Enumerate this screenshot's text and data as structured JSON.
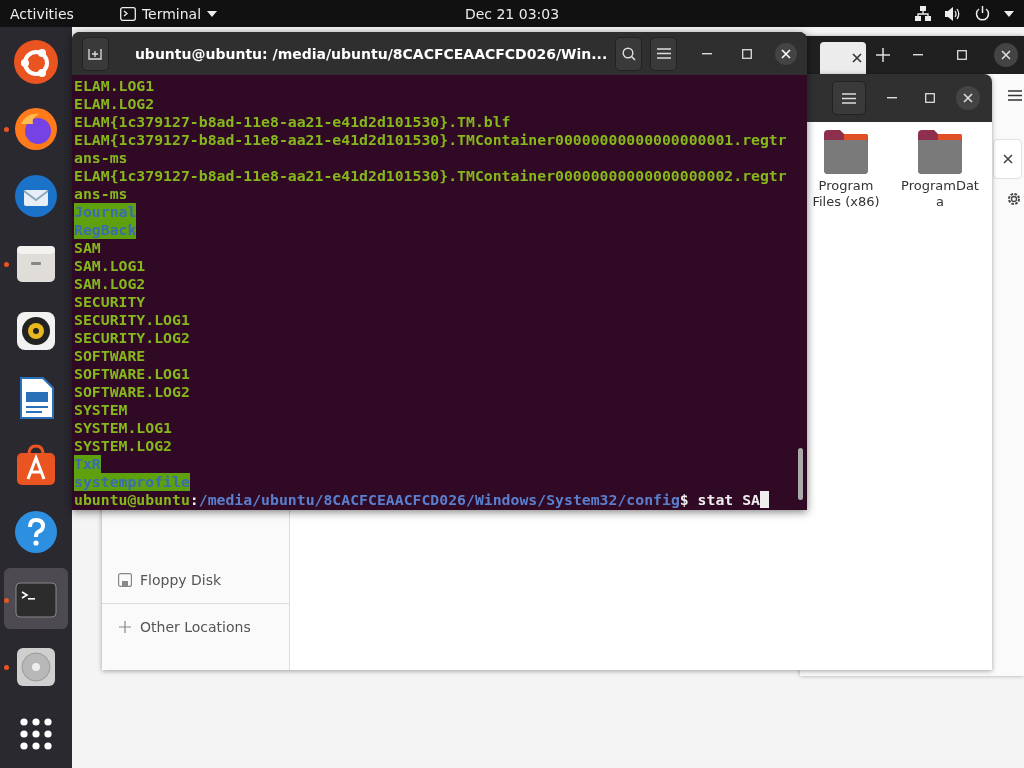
{
  "top_bar": {
    "activities": "Activities",
    "app_menu": "Terminal",
    "clock": "Dec 21  03:03"
  },
  "dock": [
    {
      "kind": "installer",
      "running": false,
      "selected": false
    },
    {
      "kind": "browser",
      "running": true,
      "selected": false
    },
    {
      "kind": "mail",
      "running": false,
      "selected": false
    },
    {
      "kind": "files",
      "running": true,
      "selected": false
    },
    {
      "kind": "music",
      "running": false,
      "selected": false
    },
    {
      "kind": "writer",
      "running": false,
      "selected": false
    },
    {
      "kind": "store",
      "running": false,
      "selected": false
    },
    {
      "kind": "help",
      "running": false,
      "selected": false
    },
    {
      "kind": "terminal",
      "running": true,
      "selected": true
    },
    {
      "kind": "disc",
      "running": true,
      "selected": false
    },
    {
      "kind": "apps",
      "running": false,
      "selected": false
    }
  ],
  "files_window": {
    "sidebar": [
      {
        "kind": "floppy",
        "label": "Floppy Disk"
      },
      {
        "kind": "other",
        "label": "Other Locations"
      }
    ],
    "folders": [
      {
        "name": "Program Files (x86)"
      },
      {
        "name": "ProgramData"
      }
    ]
  },
  "terminal": {
    "title": "ubuntu@ubuntu: /media/ubuntu/8CACFCEAACFCD026/Win...",
    "lines": [
      {
        "kind": "file",
        "text": "ELAM.LOG1"
      },
      {
        "kind": "file",
        "text": "ELAM.LOG2"
      },
      {
        "kind": "file",
        "text": "ELAM{1c379127-b8ad-11e8-aa21-e41d2d101530}.TM.blf"
      },
      {
        "kind": "file",
        "text": "ELAM{1c379127-b8ad-11e8-aa21-e41d2d101530}.TMContainer00000000000000000001.regtr"
      },
      {
        "kind": "file",
        "text": "ans-ms"
      },
      {
        "kind": "file",
        "text": "ELAM{1c379127-b8ad-11e8-aa21-e41d2d101530}.TMContainer00000000000000000002.regtr"
      },
      {
        "kind": "file",
        "text": "ans-ms"
      },
      {
        "kind": "dir",
        "text": "Journal"
      },
      {
        "kind": "dir",
        "text": "RegBack"
      },
      {
        "kind": "file",
        "text": "SAM"
      },
      {
        "kind": "file",
        "text": "SAM.LOG1"
      },
      {
        "kind": "file",
        "text": "SAM.LOG2"
      },
      {
        "kind": "file",
        "text": "SECURITY"
      },
      {
        "kind": "file",
        "text": "SECURITY.LOG1"
      },
      {
        "kind": "file",
        "text": "SECURITY.LOG2"
      },
      {
        "kind": "file",
        "text": "SOFTWARE"
      },
      {
        "kind": "file",
        "text": "SOFTWARE.LOG1"
      },
      {
        "kind": "file",
        "text": "SOFTWARE.LOG2"
      },
      {
        "kind": "file",
        "text": "SYSTEM"
      },
      {
        "kind": "file",
        "text": "SYSTEM.LOG1"
      },
      {
        "kind": "file",
        "text": "SYSTEM.LOG2"
      },
      {
        "kind": "dir",
        "text": "TxR"
      },
      {
        "kind": "dir",
        "text": "systemprofile"
      }
    ],
    "prompt": {
      "user": "ubuntu@ubuntu",
      "separator": ":",
      "path": "/media/ubuntu/8CACFCEAACFCD026/Windows/System32/config",
      "command": "$ stat SA"
    }
  }
}
